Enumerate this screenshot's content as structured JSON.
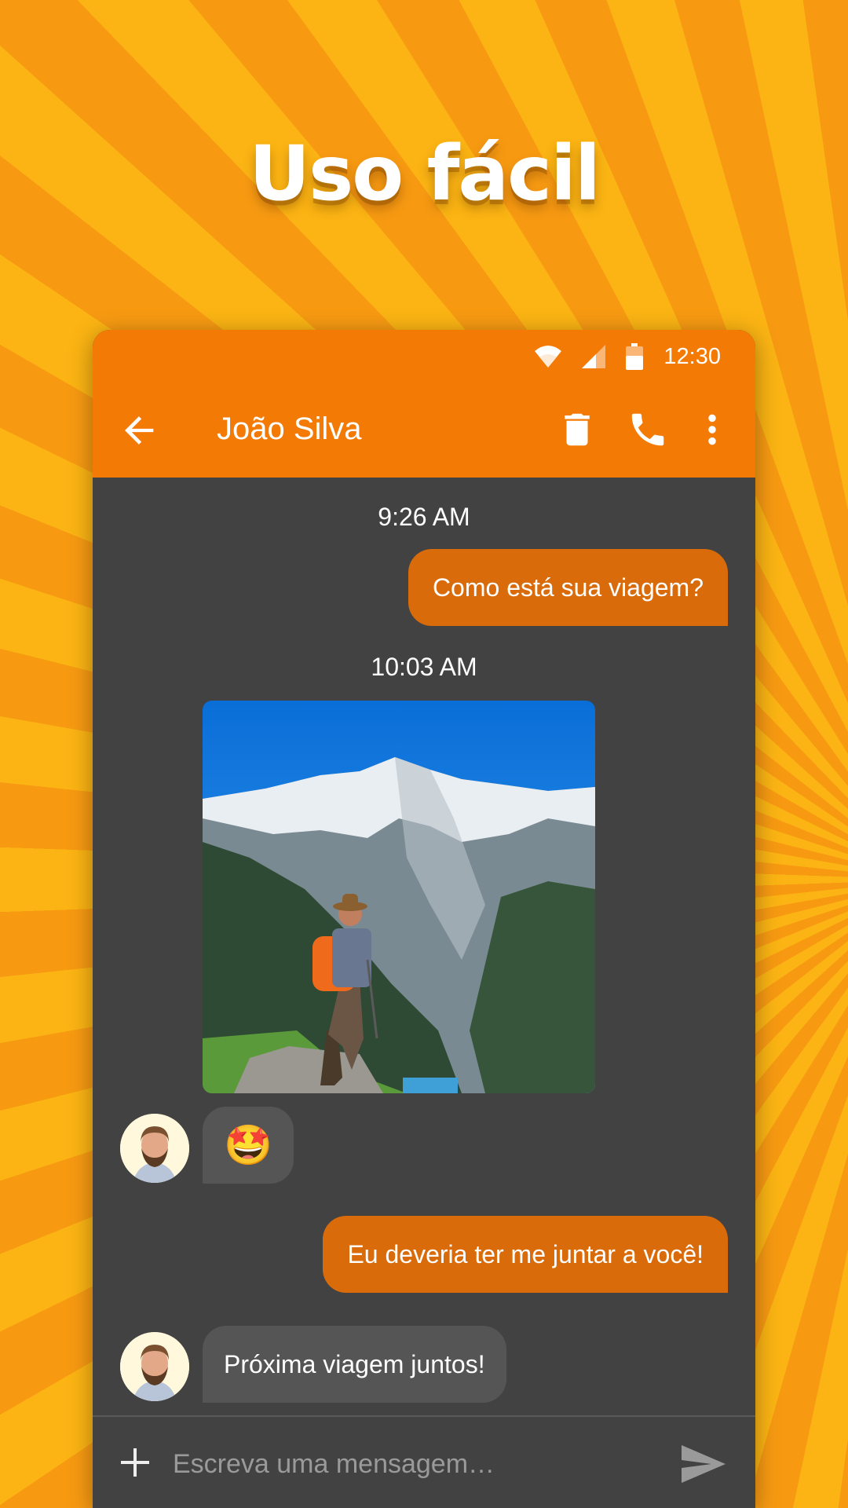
{
  "headline": "Uso fácil",
  "status": {
    "time": "12:30"
  },
  "toolbar": {
    "contact_name": "João Silva"
  },
  "messages": {
    "time_1": "9:26 AM",
    "out_1": "Como está sua viagem?",
    "time_2": "10:03 AM",
    "in_emoji": "🤩",
    "out_2": "Eu deveria ter me juntar a você!",
    "in_2": "Próxima viagem juntos!"
  },
  "composer": {
    "placeholder": "Escreva uma mensagem…"
  },
  "colors": {
    "accent": "#f47a06",
    "outgoing_bubble": "#d96b0b",
    "incoming_bubble": "#555555",
    "chat_background": "#424242"
  },
  "icons": [
    "wifi-icon",
    "signal-icon",
    "battery-icon",
    "back-arrow-icon",
    "trash-icon",
    "phone-icon",
    "more-vert-icon",
    "plus-icon",
    "send-icon"
  ]
}
